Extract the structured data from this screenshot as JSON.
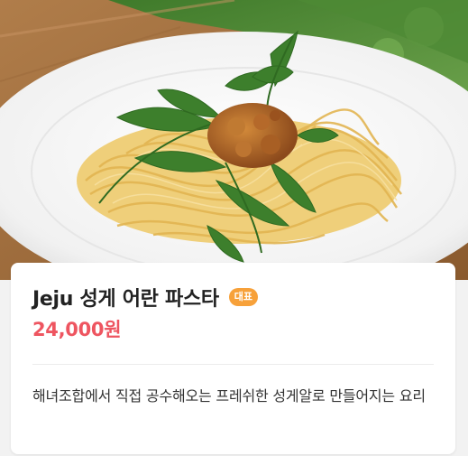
{
  "menu": {
    "name": "Jeju 성게 어란 파스타",
    "badge": "대표",
    "price": "24,000원",
    "description": "해녀조합에서 직접 공수해오는 프레쉬한 성게알로 만들어지는 요리"
  },
  "colors": {
    "badge": "#f7a13a",
    "price": "#ee5560",
    "title": "#222222",
    "description": "#333333"
  }
}
